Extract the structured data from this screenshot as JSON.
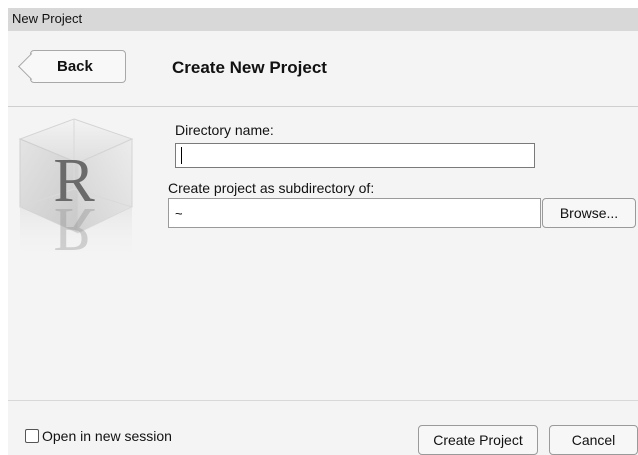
{
  "window": {
    "title": "New Project"
  },
  "header": {
    "back_label": "Back",
    "title": "Create New Project"
  },
  "logo": {
    "letter": "R"
  },
  "form": {
    "directory_label": "Directory name:",
    "directory_value": "",
    "subdir_label": "Create project as subdirectory of:",
    "subdir_value": "~",
    "browse_label": "Browse..."
  },
  "footer": {
    "open_new_session_label": "Open in new session",
    "open_new_session_checked": false,
    "create_label": "Create Project",
    "cancel_label": "Cancel"
  }
}
